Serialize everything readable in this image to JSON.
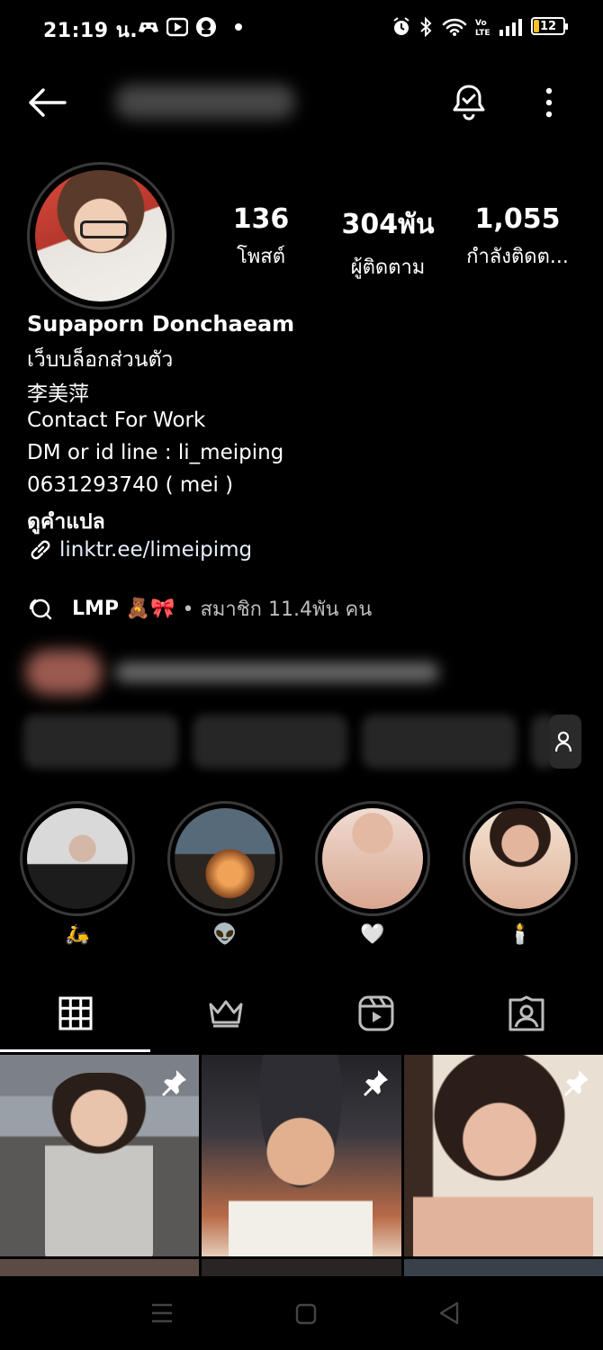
{
  "status_bar": {
    "time": "21:19 น.",
    "battery": "12",
    "icons": [
      "game-icon",
      "youtube-icon",
      "app-icon",
      "dot-icon",
      "alarm-icon",
      "bluetooth-icon",
      "wifi-icon",
      "volte-icon",
      "signal-icon",
      "battery-icon"
    ]
  },
  "header": {
    "username_blurred": "li_meiping",
    "icons": [
      "back-arrow-icon",
      "notification-bell-icon",
      "more-vertical-icon"
    ]
  },
  "stats": [
    {
      "num": "136",
      "label": "โพสต์"
    },
    {
      "num": "304พัน",
      "label": "ผู้ติดตาม"
    },
    {
      "num": "1,055",
      "label": "กำลังติดต..."
    }
  ],
  "bio": {
    "name": "Supaporn Donchaeam",
    "category": "เว็บบล็อกส่วนตัว",
    "line1": "李美萍",
    "line2": "Contact For Work",
    "line3": "DM or id line : li_meiping",
    "line4": "0631293740 ( mei )",
    "translate": "ดูคำแปล",
    "link": "linktr.ee/limeipimg"
  },
  "channel": {
    "name": "LMP 🧸🎀",
    "meta": "• สมาชิก 11.4พัน คน"
  },
  "highlights": [
    {
      "label": "🛵",
      "colors": [
        "#cfcfcf",
        "#1b1b1b"
      ]
    },
    {
      "label": "👽",
      "colors": [
        "#c77b3c",
        "#1d1a18"
      ]
    },
    {
      "label": "🤍",
      "colors": [
        "#e6c3b5",
        "#f1ddd3"
      ]
    },
    {
      "label": "🕯️",
      "colors": [
        "#d9b39c",
        "#f3e6d8"
      ]
    }
  ],
  "tabs": [
    "grid-icon",
    "crown-icon",
    "reels-icon",
    "tagged-icon"
  ],
  "posts": [
    {
      "pinned": true,
      "colors": [
        "#8a8f99",
        "#c9b8aa",
        "#4a4a4a"
      ]
    },
    {
      "pinned": true,
      "colors": [
        "#2a2a30",
        "#e3b08d",
        "#c46a4a"
      ]
    },
    {
      "pinned": true,
      "colors": [
        "#e7dccf",
        "#e3b7a0",
        "#3a2a22"
      ]
    }
  ],
  "nav": [
    "recents-icon",
    "home-icon",
    "back-icon"
  ]
}
